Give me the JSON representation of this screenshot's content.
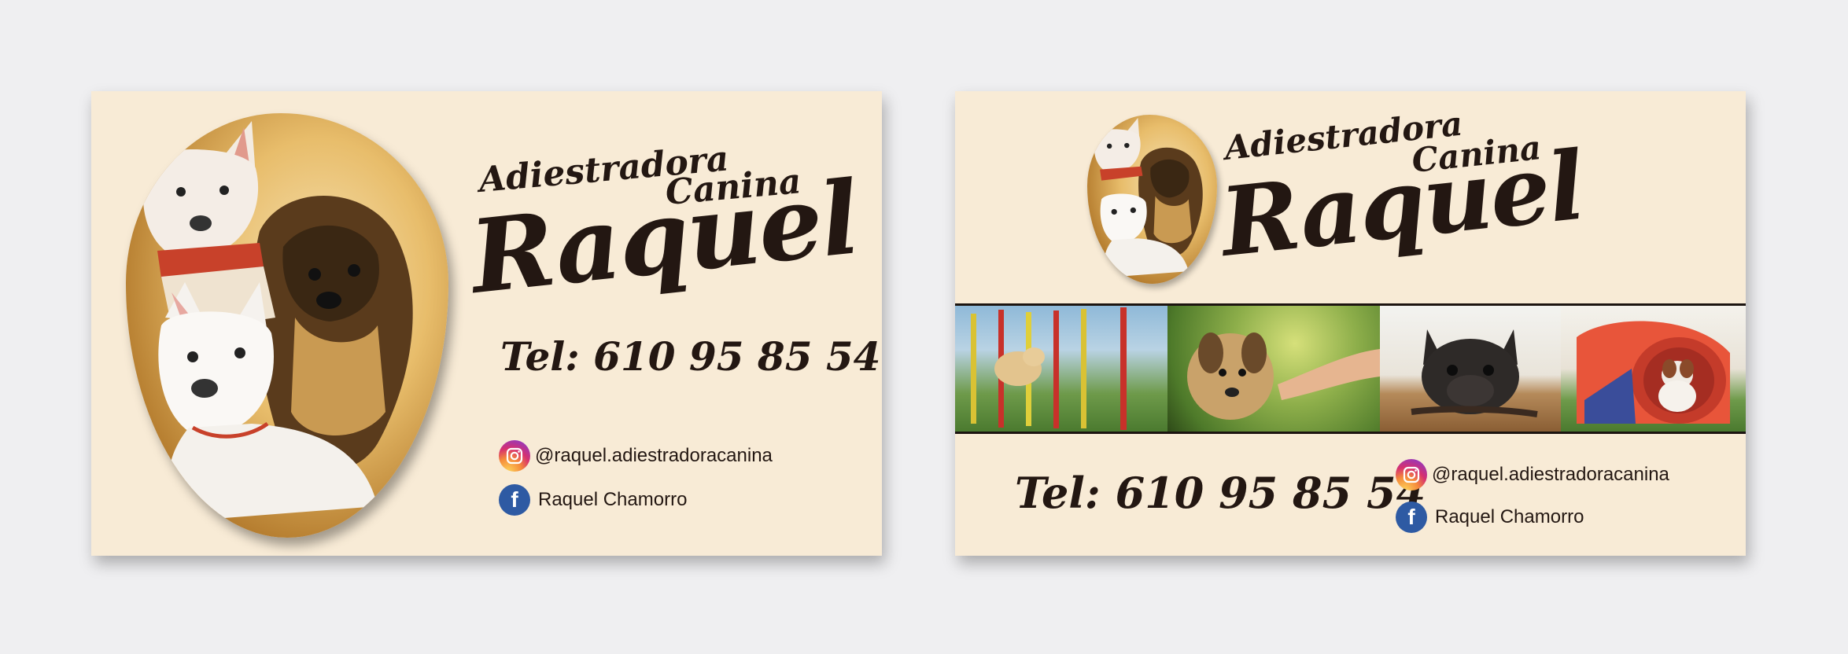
{
  "cards": {
    "front": {
      "title_line1": "Adiestradora",
      "title_line2": "Canina",
      "name": "Raquel",
      "phone": "Tel: 610 95 85 54",
      "instagram": "@raquel.adiestradoracanina",
      "facebook": "Raquel Chamorro",
      "illustration": "three-dogs-portrait"
    },
    "back": {
      "title_line1": "Adiestradora",
      "title_line2": "Canina",
      "name": "Raquel",
      "phone": "Tel: 610 95 85 54",
      "instagram": "@raquel.adiestradoracanina",
      "facebook": "Raquel Chamorro",
      "illustration": "three-dogs-portrait",
      "photo_strip": [
        "dog-agility-weave-poles",
        "puppy-giving-paw",
        "french-bulldog-with-leash",
        "dog-in-agility-tunnel"
      ]
    }
  },
  "colors": {
    "card_background": "#f8ebd6",
    "text": "#231712",
    "facebook_blue": "#2e5aa3",
    "page_background": "#efeff1"
  },
  "icons": {
    "instagram": "instagram-icon",
    "facebook": "facebook-icon",
    "facebook_glyph": "f"
  }
}
